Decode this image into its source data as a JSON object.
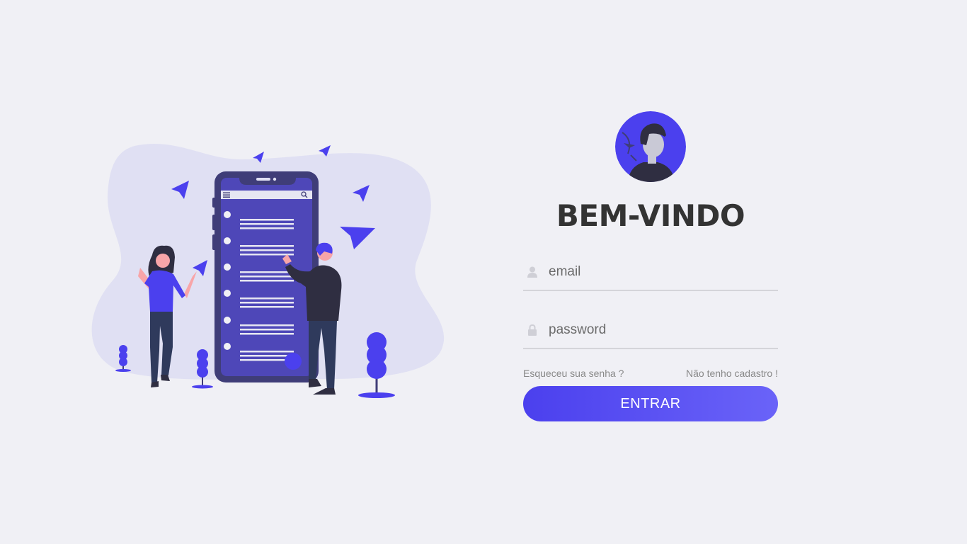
{
  "login": {
    "title": "BEM-VINDO",
    "email_placeholder": "email",
    "password_placeholder": "password",
    "forgot_label": "Esqueceu sua senha ?",
    "register_label": "Não tenho cadastro !",
    "submit_label": "ENTRAR"
  },
  "icons": {
    "avatar": "user-avatar-icon",
    "email": "user-icon",
    "password": "lock-icon"
  },
  "colors": {
    "background": "#f0f0f5",
    "accent": "#4b40ee",
    "accent_light": "#6a63f8",
    "title": "#333333",
    "blob": "#e0e0f3"
  }
}
